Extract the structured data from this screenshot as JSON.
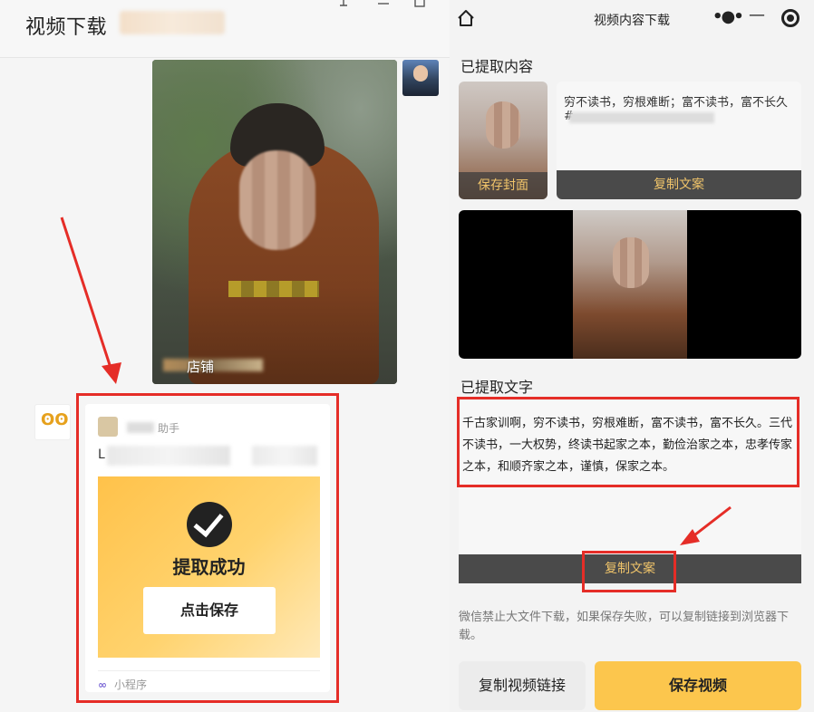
{
  "left": {
    "title": "视频下载",
    "window_controls": {
      "pin": "pin-icon",
      "minimize": "minimize-icon",
      "maximize": "maximize-icon"
    },
    "video_card": {
      "caption": "店铺"
    },
    "miniprogram_card": {
      "source_name": "助手",
      "description": "L",
      "banner": {
        "title": "提取成功",
        "button": "点击保存"
      },
      "footer": "小程序"
    }
  },
  "right": {
    "nav": {
      "title": "视频内容下载",
      "icons": [
        "home-icon",
        "more-icon",
        "minus-icon",
        "target-icon"
      ]
    },
    "section_content_title": "已提取内容",
    "save_cover_label": "保存封面",
    "copy_caption_text": "穷不读书，穷根难断；富不读书，富不长久",
    "copy_caption_hashtag": "#",
    "copy_caption_button": "复制文案",
    "section_text_title": "已提取文字",
    "extracted_text": "千古家训啊，穷不读书，穷根难断，富不读书，富不长久。三代不读书，一大权势，终读书起家之本，勤俭治家之本，忠孝传家之本，和顺齐家之本，谨慎，保家之本。",
    "copy_text_button": "复制文案",
    "notice": "微信禁止大文件下载，如果保存失败，可以复制链接到浏览器下载。",
    "copy_link_button": "复制视频链接",
    "save_video_button": "保存视频"
  },
  "colors": {
    "annotation_red": "#e52d27",
    "accent_yellow": "#fcc64d",
    "bar_text": "#f0c46a",
    "bar_bg": "#4a4a4a"
  }
}
